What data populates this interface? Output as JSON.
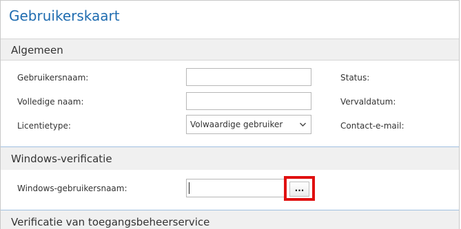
{
  "page_title": "Gebruikerskaart",
  "sections": {
    "general": {
      "header": "Algemeen",
      "username_label": "Gebruikersnaam:",
      "username_value": "",
      "full_name_label": "Volledige naam:",
      "full_name_value": "",
      "license_type_label": "Licentietype:",
      "license_type_value": "Volwaardige gebruiker",
      "status_label": "Status:",
      "expiry_label": "Vervaldatum:",
      "contact_email_label": "Contact-e-mail:"
    },
    "windows_auth": {
      "header": "Windows-verificatie",
      "windows_username_label": "Windows-gebruikersnaam:",
      "windows_username_value": "",
      "browse_label": "..."
    },
    "access_control": {
      "header": "Verificatie van toegangsbeheerservice"
    }
  },
  "colors": {
    "title": "#1f6cb0",
    "section_background": "#f0f0f0",
    "highlight": "#e01010"
  },
  "icons": {
    "dropdown": "chevron-down-icon"
  }
}
